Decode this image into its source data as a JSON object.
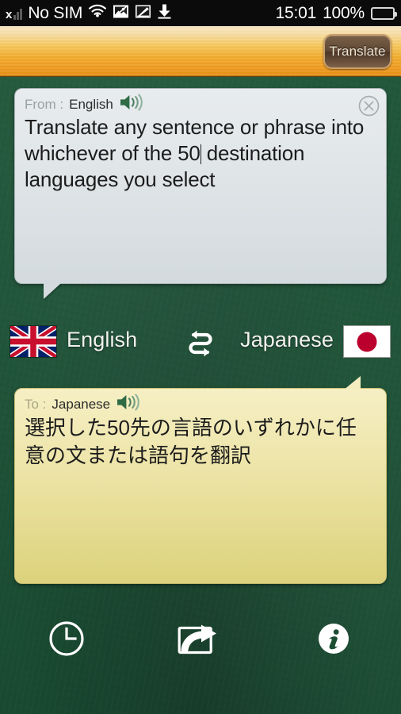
{
  "status_bar": {
    "carrier": "No SIM",
    "time": "15:01",
    "battery_percent": "100%",
    "icons": [
      "signal-no-service-icon",
      "wifi-icon",
      "screenshot-icon",
      "usb-debug-icon",
      "download-icon",
      "battery-icon"
    ]
  },
  "toolbar": {
    "translate_label": "Translate"
  },
  "input_bubble": {
    "direction_label": "From :",
    "language": "English",
    "text_before_caret": "Translate any sentence or phrase into whichever of the 50",
    "text_after_caret": " destination languages you select",
    "full_text": "Translate any sentence or phrase into whichever of the 50 destination languages you select",
    "speaker_icon": "speaker-icon",
    "close_icon": "close-circle-icon"
  },
  "language_selector": {
    "source_language": "English",
    "source_flag": "flag-united-kingdom",
    "target_language": "Japanese",
    "target_flag": "flag-japan",
    "swap_icon": "swap-arrows-icon"
  },
  "output_bubble": {
    "direction_label": "To :",
    "language": "Japanese",
    "text": "選択した50先の言語のいずれかに任意の文または語句を翻訳",
    "speaker_icon": "speaker-icon"
  },
  "bottom_bar": {
    "buttons": [
      {
        "name": "history",
        "icon": "clock-icon"
      },
      {
        "name": "share",
        "icon": "share-icon"
      },
      {
        "name": "info",
        "icon": "info-icon"
      }
    ]
  },
  "colors": {
    "board_green": "#1e5338",
    "toolbar_orange": "#f0a828",
    "input_bubble_gray": "#dfe4e7",
    "output_bubble_yellow": "#ece3a5",
    "speaker_green": "#2f6b45",
    "accent_button_brown": "#5f4835"
  }
}
